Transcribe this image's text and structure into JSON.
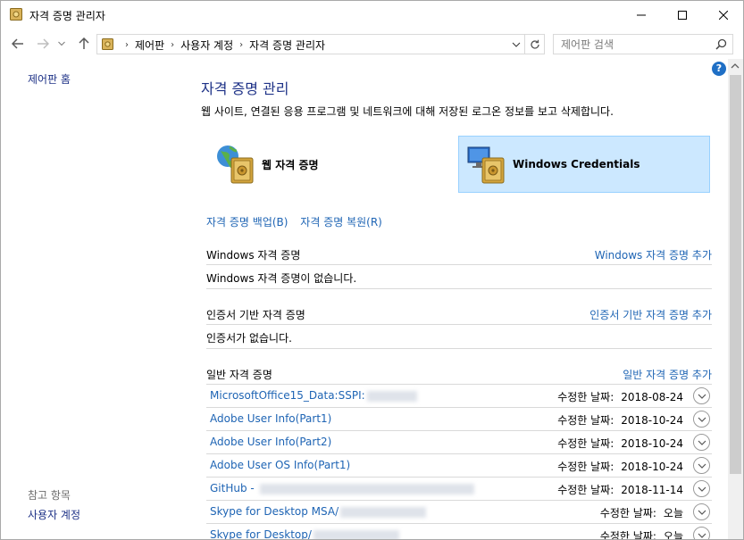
{
  "window": {
    "title": "자격 증명 관리자"
  },
  "nav": {
    "breadcrumbs": [
      "제어판",
      "사용자 계정",
      "자격 증명 관리자"
    ],
    "search_placeholder": "제어판 검색"
  },
  "left_pane": {
    "home_link": "제어판 홈",
    "see_also_label": "참고 항목",
    "see_also_items": [
      "사용자 계정"
    ]
  },
  "main": {
    "heading": "자격 증명 관리",
    "description": "웹 사이트, 연결된 응용 프로그램 및 네트워크에 대해 저장된 로그온 정보를 보고 삭제합니다.",
    "categories": [
      {
        "label": "웹 자격 증명",
        "selected": false
      },
      {
        "label": "Windows Credentials",
        "selected": true
      }
    ],
    "actions": {
      "backup": "자격 증명 백업(B)",
      "restore": "자격 증명 복원(R)"
    },
    "sections": [
      {
        "title": "Windows 자격 증명",
        "add_link": "Windows 자격 증명 추가",
        "empty_text": "Windows 자격 증명이 없습니다."
      },
      {
        "title": "인증서 기반 자격 증명",
        "add_link": "인증서 기반 자격 증명 추가",
        "empty_text": "인증서가 없습니다."
      },
      {
        "title": "일반 자격 증명",
        "add_link": "일반 자격 증명 추가"
      }
    ],
    "generic_credentials": [
      {
        "name": "MicrosoftOffice15_Data:SSPI:",
        "modified_label": "수정한 날짜:",
        "modified": "2018-08-24"
      },
      {
        "name": "Adobe User Info(Part1)",
        "modified_label": "수정한 날짜:",
        "modified": "2018-10-24"
      },
      {
        "name": "Adobe User Info(Part2)",
        "modified_label": "수정한 날짜:",
        "modified": "2018-10-24"
      },
      {
        "name": "Adobe User OS Info(Part1)",
        "modified_label": "수정한 날짜:",
        "modified": "2018-10-24"
      },
      {
        "name": "GitHub - ",
        "modified_label": "수정한 날짜:",
        "modified": "2018-11-14"
      },
      {
        "name": "Skype for Desktop MSA/",
        "modified_label": "수정한 날짜:",
        "modified": "오늘"
      },
      {
        "name": "Skype for Desktop/",
        "modified_label": "수정한 날짜:",
        "modified": "오늘"
      }
    ]
  },
  "colors": {
    "link": "#1e64b4",
    "heading": "#1e3287",
    "selected_bg": "#cce8ff",
    "help": "#1f6fc5"
  }
}
